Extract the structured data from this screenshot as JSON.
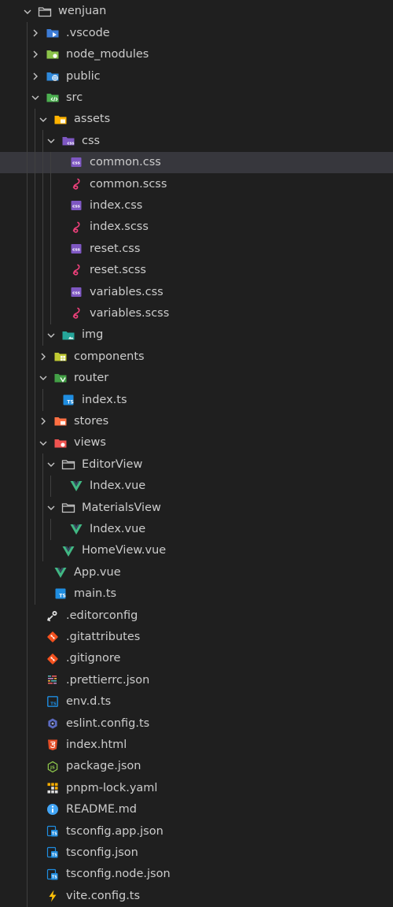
{
  "explorer": {
    "selected": "common.css",
    "items": [
      {
        "label": "wenjuan",
        "depth": 0,
        "type": "folder",
        "open": true,
        "icon": "folder-icon"
      },
      {
        "label": ".vscode",
        "depth": 1,
        "type": "folder",
        "open": false,
        "icon": "folder-vscode-icon"
      },
      {
        "label": "node_modules",
        "depth": 1,
        "type": "folder",
        "open": false,
        "icon": "folder-node-icon"
      },
      {
        "label": "public",
        "depth": 1,
        "type": "folder",
        "open": false,
        "icon": "folder-public-icon"
      },
      {
        "label": "src",
        "depth": 1,
        "type": "folder",
        "open": true,
        "icon": "folder-src-icon"
      },
      {
        "label": "assets",
        "depth": 2,
        "type": "folder",
        "open": true,
        "icon": "folder-assets-icon"
      },
      {
        "label": "css",
        "depth": 3,
        "type": "folder",
        "open": true,
        "icon": "folder-css-icon"
      },
      {
        "label": "common.css",
        "depth": 4,
        "type": "file",
        "icon": "css-file-icon",
        "selected": true
      },
      {
        "label": "common.scss",
        "depth": 4,
        "type": "file",
        "icon": "sass-file-icon"
      },
      {
        "label": "index.css",
        "depth": 4,
        "type": "file",
        "icon": "css-file-icon"
      },
      {
        "label": "index.scss",
        "depth": 4,
        "type": "file",
        "icon": "sass-file-icon"
      },
      {
        "label": "reset.css",
        "depth": 4,
        "type": "file",
        "icon": "css-file-icon"
      },
      {
        "label": "reset.scss",
        "depth": 4,
        "type": "file",
        "icon": "sass-file-icon"
      },
      {
        "label": "variables.css",
        "depth": 4,
        "type": "file",
        "icon": "css-file-icon"
      },
      {
        "label": "variables.scss",
        "depth": 4,
        "type": "file",
        "icon": "sass-file-icon"
      },
      {
        "label": "img",
        "depth": 3,
        "type": "folder",
        "open": true,
        "icon": "folder-images-icon"
      },
      {
        "label": "components",
        "depth": 2,
        "type": "folder",
        "open": false,
        "icon": "folder-components-icon"
      },
      {
        "label": "router",
        "depth": 2,
        "type": "folder",
        "open": true,
        "icon": "folder-router-icon"
      },
      {
        "label": "index.ts",
        "depth": 3,
        "type": "file",
        "icon": "ts-file-icon"
      },
      {
        "label": "stores",
        "depth": 2,
        "type": "folder",
        "open": false,
        "icon": "folder-stores-icon"
      },
      {
        "label": "views",
        "depth": 2,
        "type": "folder",
        "open": true,
        "icon": "folder-views-icon"
      },
      {
        "label": "EditorView",
        "depth": 3,
        "type": "folder",
        "open": true,
        "icon": "folder-icon"
      },
      {
        "label": "Index.vue",
        "depth": 4,
        "type": "file",
        "icon": "vue-file-icon"
      },
      {
        "label": "MaterialsView",
        "depth": 3,
        "type": "folder",
        "open": true,
        "icon": "folder-icon"
      },
      {
        "label": "Index.vue",
        "depth": 4,
        "type": "file",
        "icon": "vue-file-icon"
      },
      {
        "label": "HomeView.vue",
        "depth": 3,
        "type": "file",
        "icon": "vue-file-icon"
      },
      {
        "label": "App.vue",
        "depth": 2,
        "type": "file",
        "icon": "vue-file-icon"
      },
      {
        "label": "main.ts",
        "depth": 2,
        "type": "file",
        "icon": "ts-file-icon"
      },
      {
        "label": ".editorconfig",
        "depth": 1,
        "type": "file",
        "icon": "editorconfig-icon"
      },
      {
        "label": ".gitattributes",
        "depth": 1,
        "type": "file",
        "icon": "git-icon"
      },
      {
        "label": ".gitignore",
        "depth": 1,
        "type": "file",
        "icon": "git-icon"
      },
      {
        "label": ".prettierrc.json",
        "depth": 1,
        "type": "file",
        "icon": "prettier-icon"
      },
      {
        "label": "env.d.ts",
        "depth": 1,
        "type": "file",
        "icon": "ts-def-icon"
      },
      {
        "label": "eslint.config.ts",
        "depth": 1,
        "type": "file",
        "icon": "eslint-icon"
      },
      {
        "label": "index.html",
        "depth": 1,
        "type": "file",
        "icon": "html-file-icon"
      },
      {
        "label": "package.json",
        "depth": 1,
        "type": "file",
        "icon": "nodejs-icon"
      },
      {
        "label": "pnpm-lock.yaml",
        "depth": 1,
        "type": "file",
        "icon": "pnpm-icon"
      },
      {
        "label": "README.md",
        "depth": 1,
        "type": "file",
        "icon": "info-icon"
      },
      {
        "label": "tsconfig.app.json",
        "depth": 1,
        "type": "file",
        "icon": "tsconfig-icon"
      },
      {
        "label": "tsconfig.json",
        "depth": 1,
        "type": "file",
        "icon": "tsconfig-icon"
      },
      {
        "label": "tsconfig.node.json",
        "depth": 1,
        "type": "file",
        "icon": "tsconfig-icon"
      },
      {
        "label": "vite.config.ts",
        "depth": 1,
        "type": "file",
        "icon": "vite-icon"
      }
    ]
  }
}
